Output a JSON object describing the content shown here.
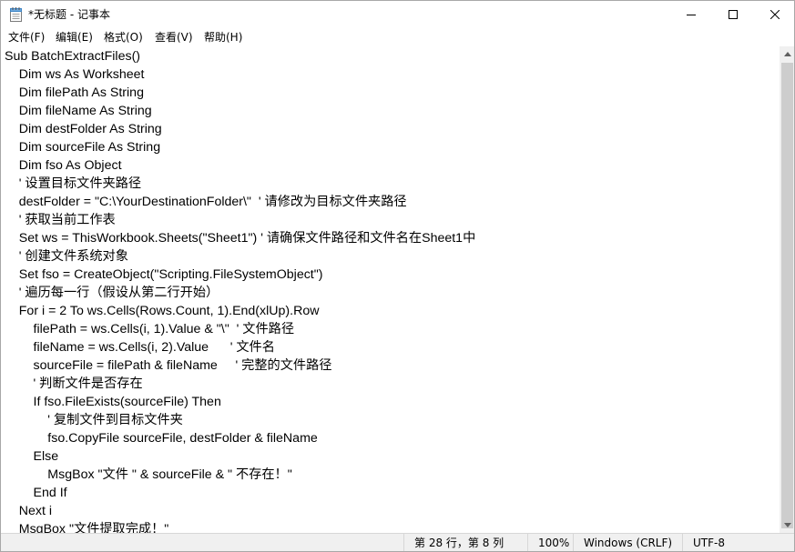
{
  "window": {
    "title": "*无标题 - 记事本",
    "app_icon": "notepad-icon",
    "controls": {
      "minimize_icon": "minimize-icon",
      "maximize_icon": "maximize-icon",
      "close_icon": "close-icon"
    }
  },
  "menu": {
    "items": [
      {
        "label": "文件(F)"
      },
      {
        "label": "编辑(E)"
      },
      {
        "label": "格式(O)"
      },
      {
        "label": "查看(V)"
      },
      {
        "label": "帮助(H)"
      }
    ]
  },
  "editor": {
    "lines": [
      "Sub BatchExtractFiles()",
      "    Dim ws As Worksheet",
      "    Dim filePath As String",
      "    Dim fileName As String",
      "    Dim destFolder As String",
      "    Dim sourceFile As String",
      "    Dim fso As Object",
      "    ' 设置目标文件夹路径",
      "    destFolder = \"C:\\YourDestinationFolder\\\"  ' 请修改为目标文件夹路径",
      "    ' 获取当前工作表",
      "    Set ws = ThisWorkbook.Sheets(\"Sheet1\") ' 请确保文件路径和文件名在Sheet1中",
      "    ' 创建文件系统对象",
      "    Set fso = CreateObject(\"Scripting.FileSystemObject\")",
      "    ' 遍历每一行（假设从第二行开始）",
      "    For i = 2 To ws.Cells(Rows.Count, 1).End(xlUp).Row",
      "        filePath = ws.Cells(i, 1).Value & \"\\\"  ' 文件路径",
      "        fileName = ws.Cells(i, 2).Value      ' 文件名",
      "        sourceFile = filePath & fileName     ' 完整的文件路径",
      "        ' 判断文件是否存在",
      "        If fso.FileExists(sourceFile) Then",
      "            ' 复制文件到目标文件夹",
      "            fso.CopyFile sourceFile, destFolder & fileName",
      "        Else",
      "            MsgBox \"文件 \" & sourceFile & \" 不存在！\"",
      "        End If",
      "    Next i",
      "    MsgBox \"文件提取完成！\""
    ]
  },
  "status": {
    "position": "第 28 行，第 8 列",
    "zoom": "100%",
    "line_ending": "Windows (CRLF)",
    "encoding": "UTF-8"
  }
}
